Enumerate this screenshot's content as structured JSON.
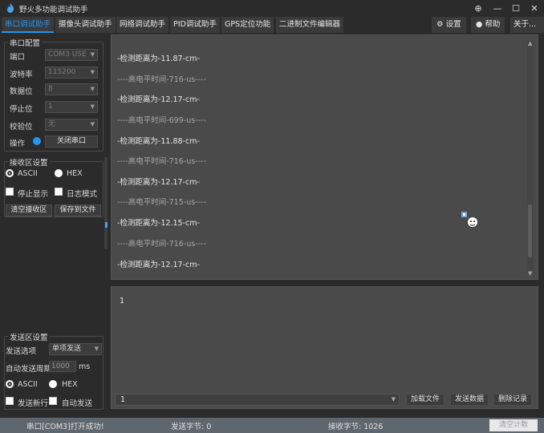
{
  "window": {
    "title": "野火多功能调试助手",
    "controls": {
      "pin": "⊕",
      "minimize": "—",
      "maximize": "☐",
      "close": "✕"
    }
  },
  "tabs": [
    {
      "label": "串口调试助手",
      "active": true
    },
    {
      "label": "摄像头调试助手"
    },
    {
      "label": "网络调试助手"
    },
    {
      "label": "PID调试助手"
    },
    {
      "label": "GPS定位功能"
    },
    {
      "label": "二进制文件编辑器"
    }
  ],
  "right_tabs": {
    "settings": "设置",
    "help": "帮助",
    "about": "关于..."
  },
  "serial_config": {
    "title": "串口配置",
    "port_label": "端口",
    "port_value": "COM3 USE",
    "baud_label": "波特率",
    "baud_value": "115200",
    "databits_label": "数据位",
    "databits_value": "8",
    "stopbits_label": "停止位",
    "stopbits_value": "1",
    "parity_label": "校验位",
    "parity_value": "无",
    "op_label": "操作",
    "op_button": "关闭串口"
  },
  "receive_settings": {
    "title": "接收区设置",
    "ascii": "ASCII",
    "hex": "HEX",
    "stop_display": "停止显示",
    "log_mode": "日志模式",
    "clear_button": "清空接收区",
    "save_button": "保存到文件"
  },
  "receive_lines": [
    "-检测距离为-11.87-cm-",
    "----高电平时间-716-us----",
    "-检测距离为-12.17-cm-",
    "----高电平时间-699-us----",
    "-检测距离为-11.88-cm-",
    "----高电平时间-716-us----",
    "-检测距离为-12.17-cm-",
    "----高电平时间-715-us----",
    "-检测距离为-12.15-cm-",
    "----高电平时间-716-us----",
    "-检测距离为-12.17-cm-"
  ],
  "send_settings": {
    "title": "发送区设置",
    "option_label": "发送选项",
    "option_value": "单项发送",
    "period_label": "自动发送周期",
    "period_value": "1000",
    "period_unit": "ms",
    "ascii": "ASCII",
    "hex": "HEX",
    "newline": "发送新行",
    "auto_send": "自动发送"
  },
  "send_text": "1",
  "send_combo_value": "1",
  "send_buttons": {
    "load": "加载文件",
    "send": "发送数据",
    "clear": "删除记录"
  },
  "status": {
    "message": "串口[COM3]打开成功!",
    "sent": "发送字节: 0",
    "received": "接收字节: 1026",
    "clear_count": "清空计数"
  },
  "colors": {
    "accent": "#2196f3",
    "status_bar": "#5f676e"
  }
}
